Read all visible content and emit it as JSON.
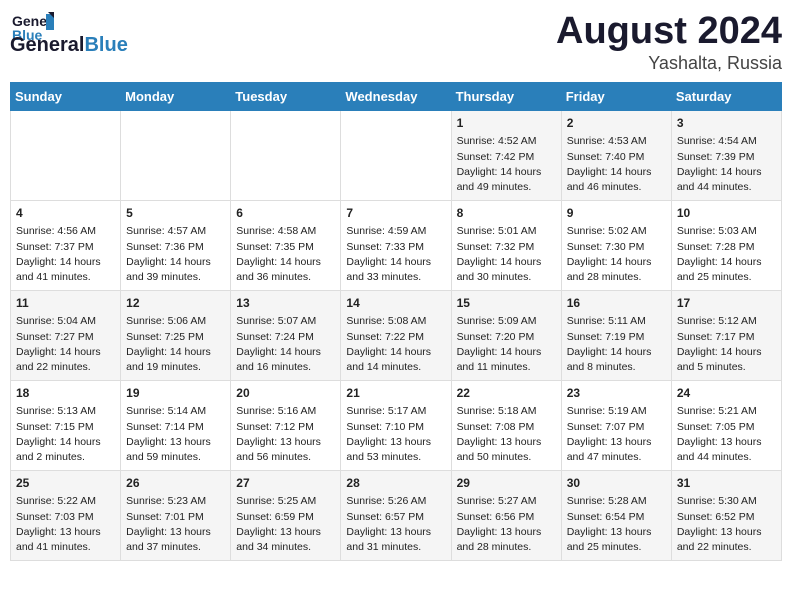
{
  "header": {
    "logo_general": "General",
    "logo_blue": "Blue",
    "title": "August 2024",
    "location": "Yashalta, Russia"
  },
  "days_of_week": [
    "Sunday",
    "Monday",
    "Tuesday",
    "Wednesday",
    "Thursday",
    "Friday",
    "Saturday"
  ],
  "weeks": [
    [
      {
        "day": "",
        "empty": true
      },
      {
        "day": "",
        "empty": true
      },
      {
        "day": "",
        "empty": true
      },
      {
        "day": "",
        "empty": true
      },
      {
        "day": "1",
        "sunrise": "4:52 AM",
        "sunset": "7:42 PM",
        "daylight": "14 hours and 49 minutes."
      },
      {
        "day": "2",
        "sunrise": "4:53 AM",
        "sunset": "7:40 PM",
        "daylight": "14 hours and 46 minutes."
      },
      {
        "day": "3",
        "sunrise": "4:54 AM",
        "sunset": "7:39 PM",
        "daylight": "14 hours and 44 minutes."
      }
    ],
    [
      {
        "day": "4",
        "sunrise": "4:56 AM",
        "sunset": "7:37 PM",
        "daylight": "14 hours and 41 minutes."
      },
      {
        "day": "5",
        "sunrise": "4:57 AM",
        "sunset": "7:36 PM",
        "daylight": "14 hours and 39 minutes."
      },
      {
        "day": "6",
        "sunrise": "4:58 AM",
        "sunset": "7:35 PM",
        "daylight": "14 hours and 36 minutes."
      },
      {
        "day": "7",
        "sunrise": "4:59 AM",
        "sunset": "7:33 PM",
        "daylight": "14 hours and 33 minutes."
      },
      {
        "day": "8",
        "sunrise": "5:01 AM",
        "sunset": "7:32 PM",
        "daylight": "14 hours and 30 minutes."
      },
      {
        "day": "9",
        "sunrise": "5:02 AM",
        "sunset": "7:30 PM",
        "daylight": "14 hours and 28 minutes."
      },
      {
        "day": "10",
        "sunrise": "5:03 AM",
        "sunset": "7:28 PM",
        "daylight": "14 hours and 25 minutes."
      }
    ],
    [
      {
        "day": "11",
        "sunrise": "5:04 AM",
        "sunset": "7:27 PM",
        "daylight": "14 hours and 22 minutes."
      },
      {
        "day": "12",
        "sunrise": "5:06 AM",
        "sunset": "7:25 PM",
        "daylight": "14 hours and 19 minutes."
      },
      {
        "day": "13",
        "sunrise": "5:07 AM",
        "sunset": "7:24 PM",
        "daylight": "14 hours and 16 minutes."
      },
      {
        "day": "14",
        "sunrise": "5:08 AM",
        "sunset": "7:22 PM",
        "daylight": "14 hours and 14 minutes."
      },
      {
        "day": "15",
        "sunrise": "5:09 AM",
        "sunset": "7:20 PM",
        "daylight": "14 hours and 11 minutes."
      },
      {
        "day": "16",
        "sunrise": "5:11 AM",
        "sunset": "7:19 PM",
        "daylight": "14 hours and 8 minutes."
      },
      {
        "day": "17",
        "sunrise": "5:12 AM",
        "sunset": "7:17 PM",
        "daylight": "14 hours and 5 minutes."
      }
    ],
    [
      {
        "day": "18",
        "sunrise": "5:13 AM",
        "sunset": "7:15 PM",
        "daylight": "14 hours and 2 minutes."
      },
      {
        "day": "19",
        "sunrise": "5:14 AM",
        "sunset": "7:14 PM",
        "daylight": "13 hours and 59 minutes."
      },
      {
        "day": "20",
        "sunrise": "5:16 AM",
        "sunset": "7:12 PM",
        "daylight": "13 hours and 56 minutes."
      },
      {
        "day": "21",
        "sunrise": "5:17 AM",
        "sunset": "7:10 PM",
        "daylight": "13 hours and 53 minutes."
      },
      {
        "day": "22",
        "sunrise": "5:18 AM",
        "sunset": "7:08 PM",
        "daylight": "13 hours and 50 minutes."
      },
      {
        "day": "23",
        "sunrise": "5:19 AM",
        "sunset": "7:07 PM",
        "daylight": "13 hours and 47 minutes."
      },
      {
        "day": "24",
        "sunrise": "5:21 AM",
        "sunset": "7:05 PM",
        "daylight": "13 hours and 44 minutes."
      }
    ],
    [
      {
        "day": "25",
        "sunrise": "5:22 AM",
        "sunset": "7:03 PM",
        "daylight": "13 hours and 41 minutes."
      },
      {
        "day": "26",
        "sunrise": "5:23 AM",
        "sunset": "7:01 PM",
        "daylight": "13 hours and 37 minutes."
      },
      {
        "day": "27",
        "sunrise": "5:25 AM",
        "sunset": "6:59 PM",
        "daylight": "13 hours and 34 minutes."
      },
      {
        "day": "28",
        "sunrise": "5:26 AM",
        "sunset": "6:57 PM",
        "daylight": "13 hours and 31 minutes."
      },
      {
        "day": "29",
        "sunrise": "5:27 AM",
        "sunset": "6:56 PM",
        "daylight": "13 hours and 28 minutes."
      },
      {
        "day": "30",
        "sunrise": "5:28 AM",
        "sunset": "6:54 PM",
        "daylight": "13 hours and 25 minutes."
      },
      {
        "day": "31",
        "sunrise": "5:30 AM",
        "sunset": "6:52 PM",
        "daylight": "13 hours and 22 minutes."
      }
    ]
  ]
}
